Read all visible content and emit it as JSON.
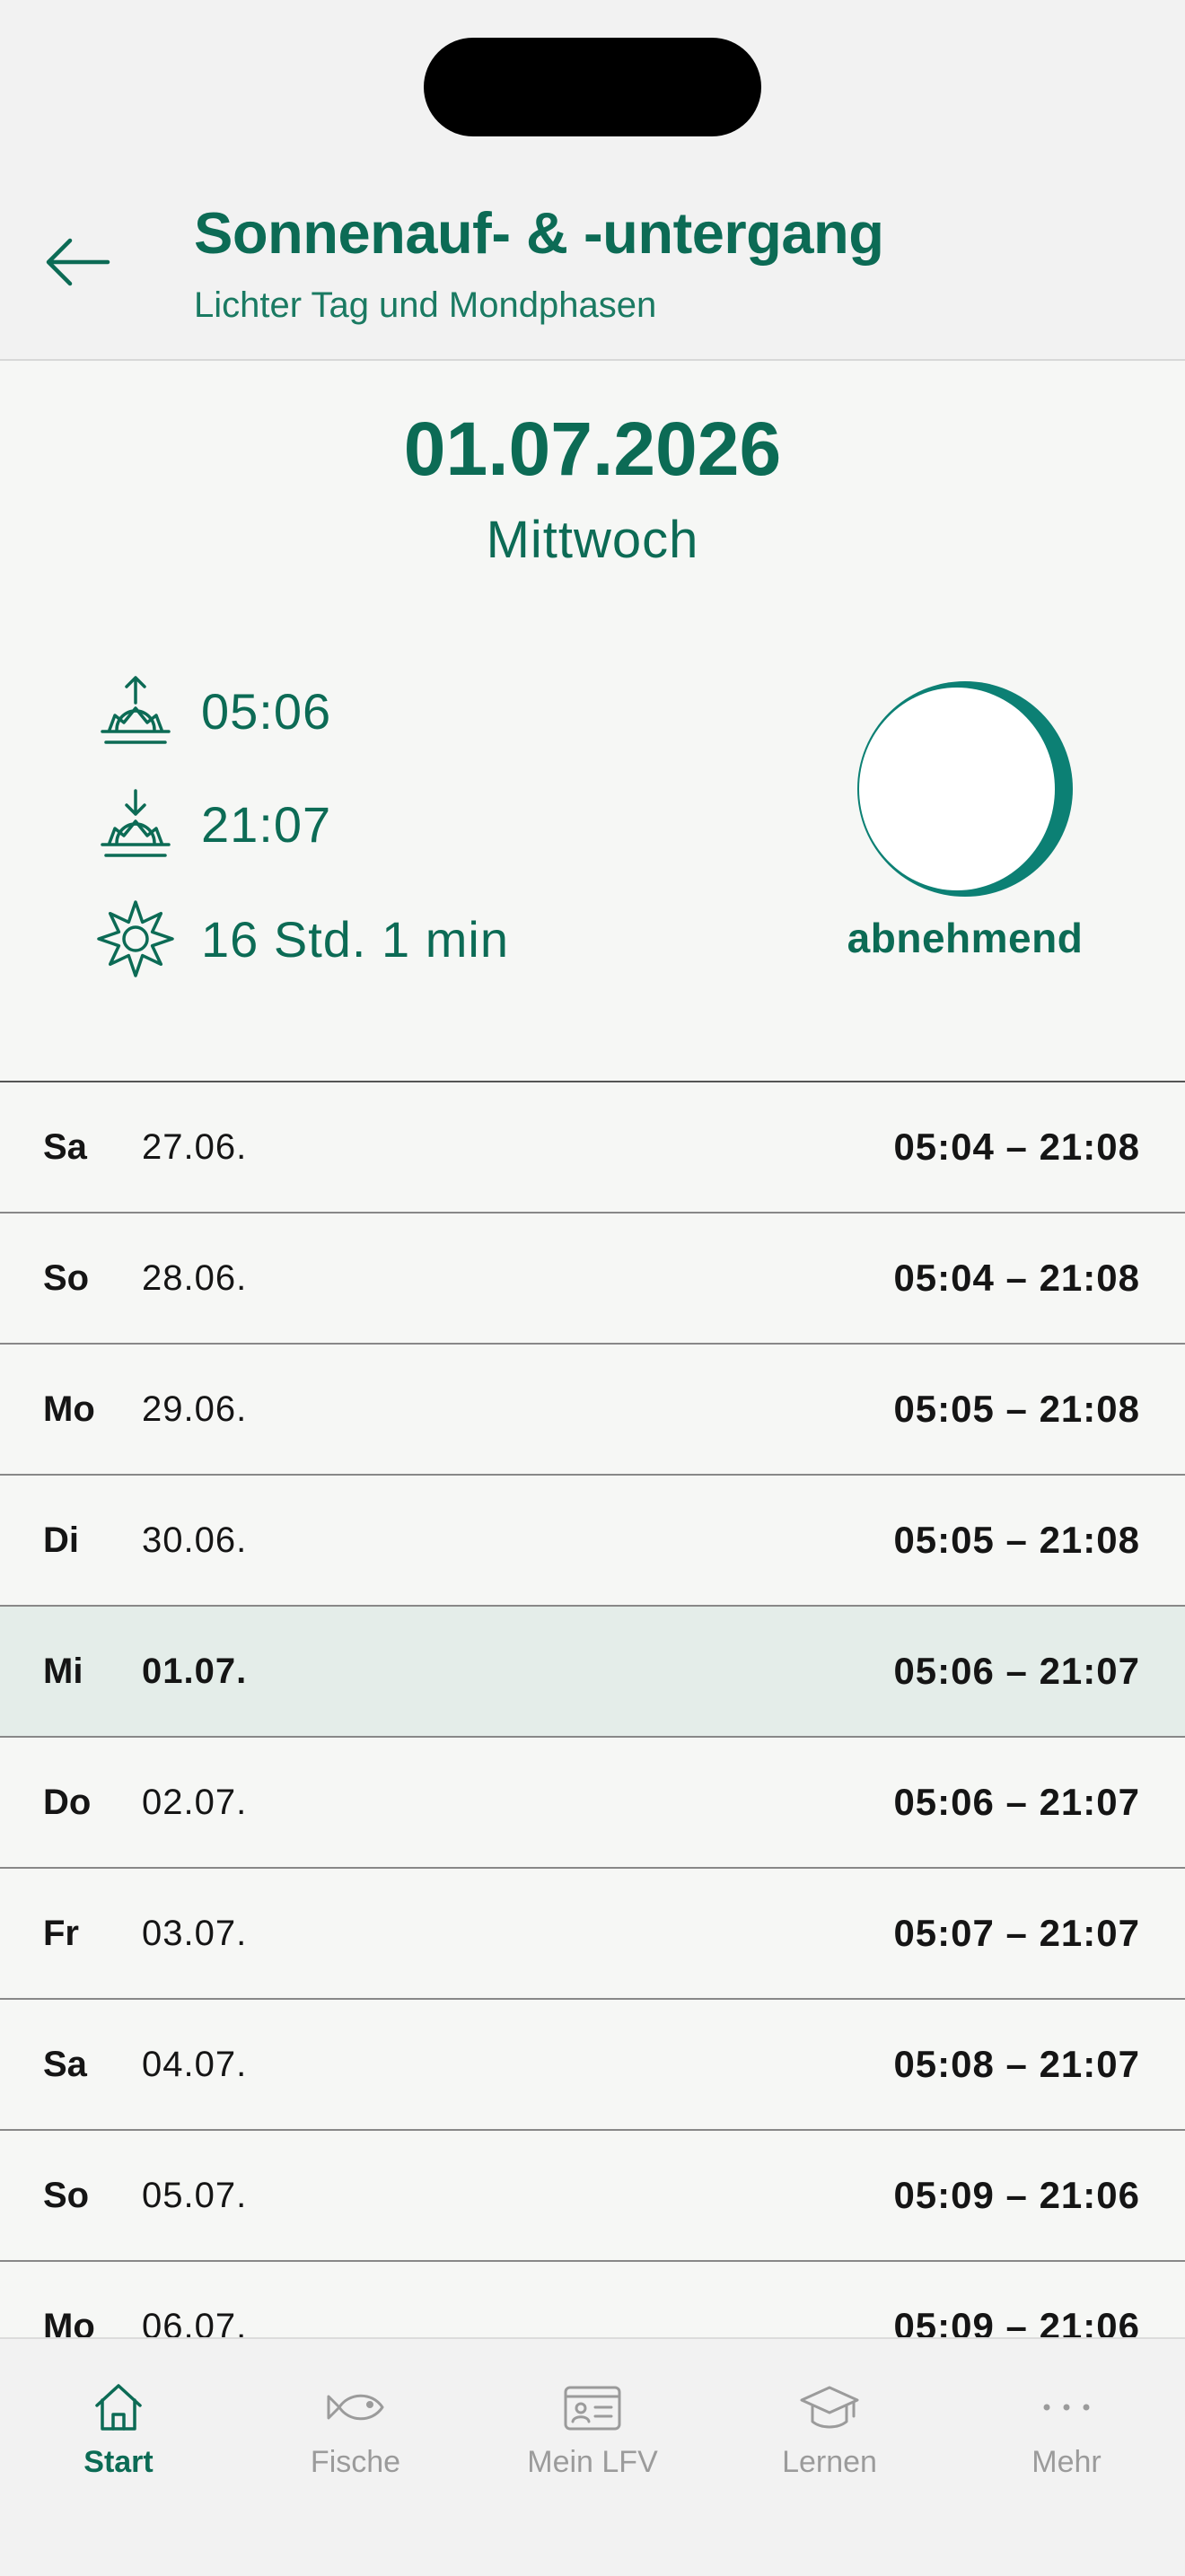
{
  "header": {
    "title": "Sonnenauf- & -untergang",
    "subtitle": "Lichter Tag und Mondphasen"
  },
  "selected": {
    "date": "01.07.2026",
    "weekday": "Mittwoch",
    "sunrise": "05:06",
    "sunset": "21:07",
    "daylight": "16 Std. 1 min",
    "moon_phase": "abnehmend"
  },
  "days": [
    {
      "weekday": "Sa",
      "date": "27.06.",
      "times": "05:04 – 21:08"
    },
    {
      "weekday": "So",
      "date": "28.06.",
      "times": "05:04 – 21:08"
    },
    {
      "weekday": "Mo",
      "date": "29.06.",
      "times": "05:05 – 21:08"
    },
    {
      "weekday": "Di",
      "date": "30.06.",
      "times": "05:05 – 21:08"
    },
    {
      "weekday": "Mi",
      "date": "01.07.",
      "times": "05:06 – 21:07"
    },
    {
      "weekday": "Do",
      "date": "02.07.",
      "times": "05:06 – 21:07"
    },
    {
      "weekday": "Fr",
      "date": "03.07.",
      "times": "05:07 – 21:07"
    },
    {
      "weekday": "Sa",
      "date": "04.07.",
      "times": "05:08 – 21:07"
    },
    {
      "weekday": "So",
      "date": "05.07.",
      "times": "05:09 – 21:06"
    },
    {
      "weekday": "Mo",
      "date": "06.07.",
      "times": "05:09 – 21:06"
    }
  ],
  "tabs": [
    {
      "label": "Start",
      "icon": "home-icon"
    },
    {
      "label": "Fische",
      "icon": "fish-icon"
    },
    {
      "label": "Mein LFV",
      "icon": "id-card-icon"
    },
    {
      "label": "Lernen",
      "icon": "graduation-cap-icon"
    },
    {
      "label": "Mehr",
      "icon": "more-dots-icon"
    }
  ],
  "colors": {
    "primary": "#0c6b55",
    "moon_ring": "#0c8074",
    "background": "#f6f7f5",
    "highlight_row": "#e4ede9",
    "inactive_tab": "#9b9b9b"
  }
}
